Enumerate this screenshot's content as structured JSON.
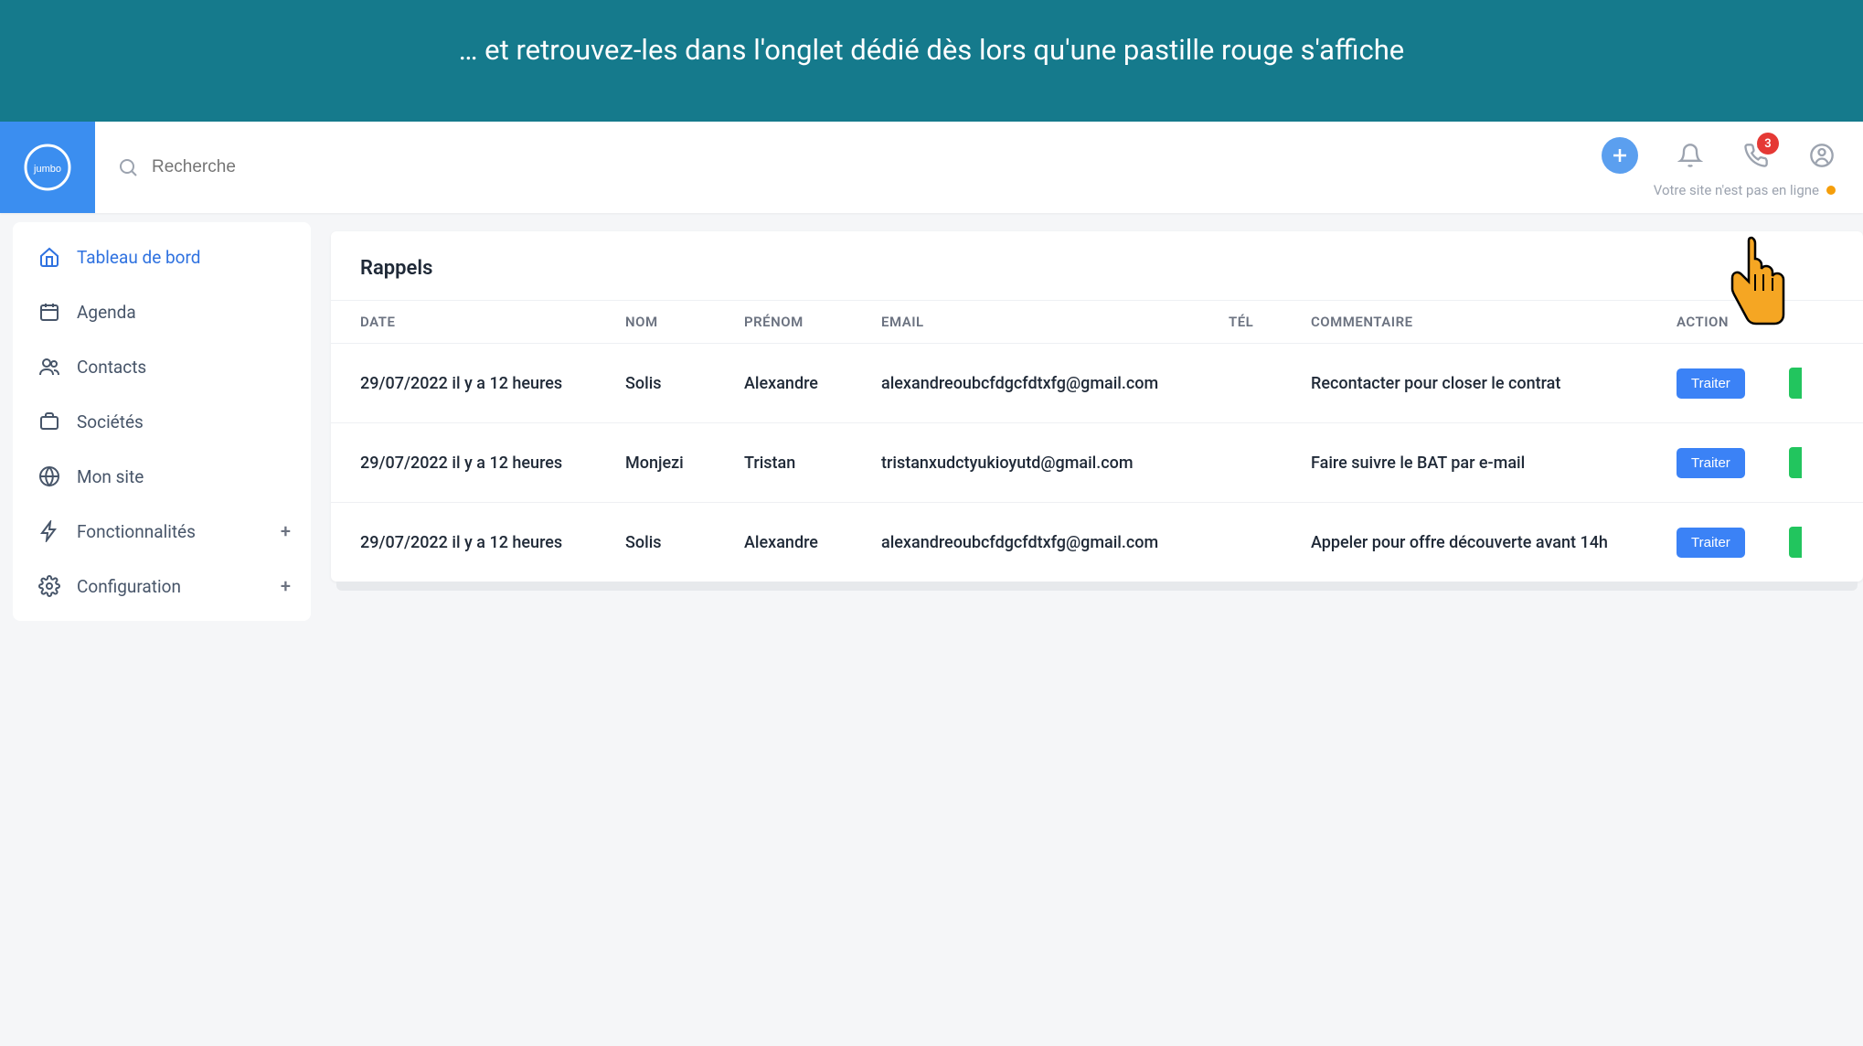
{
  "banner": {
    "text": "… et retrouvez-les dans l'onglet dédié dès lors qu'une pastille rouge s'affiche"
  },
  "logo": {
    "name": "jumbo"
  },
  "search": {
    "placeholder": "Recherche"
  },
  "header": {
    "badge_count": "3",
    "status_text": "Votre site n'est pas en ligne"
  },
  "sidebar": {
    "items": [
      {
        "label": "Tableau de bord",
        "icon": "home",
        "active": true
      },
      {
        "label": "Agenda",
        "icon": "calendar"
      },
      {
        "label": "Contacts",
        "icon": "users"
      },
      {
        "label": "Sociétés",
        "icon": "briefcase"
      },
      {
        "label": "Mon site",
        "icon": "globe"
      },
      {
        "label": "Fonctionnalités",
        "icon": "bolt",
        "expandable": true
      },
      {
        "label": "Configuration",
        "icon": "gear",
        "expandable": true
      }
    ]
  },
  "card": {
    "title": "Rappels"
  },
  "table": {
    "headers": {
      "date": "DATE",
      "nom": "NOM",
      "prenom": "PRÉNOM",
      "email": "EMAIL",
      "tel": "TÉL",
      "comment": "COMMENTAIRE",
      "action": "ACTION"
    },
    "rows": [
      {
        "date": "29/07/2022 il y a 12 heures",
        "nom": "Solis",
        "prenom": "Alexandre",
        "email": "alexandreoubcfdgcfdtxfg@gmail.com",
        "tel": "",
        "comment": "Recontacter pour closer le contrat",
        "action": "Traiter"
      },
      {
        "date": "29/07/2022 il y a 12 heures",
        "nom": "Monjezi",
        "prenom": "Tristan",
        "email": "tristanxudctyukioyutd@gmail.com",
        "tel": "",
        "comment": "Faire suivre le BAT par e-mail",
        "action": "Traiter"
      },
      {
        "date": "29/07/2022 il y a 12 heures",
        "nom": "Solis",
        "prenom": "Alexandre",
        "email": "alexandreoubcfdgcfdtxfg@gmail.com",
        "tel": "",
        "comment": "Appeler pour offre découverte avant 14h",
        "action": "Traiter"
      }
    ]
  }
}
